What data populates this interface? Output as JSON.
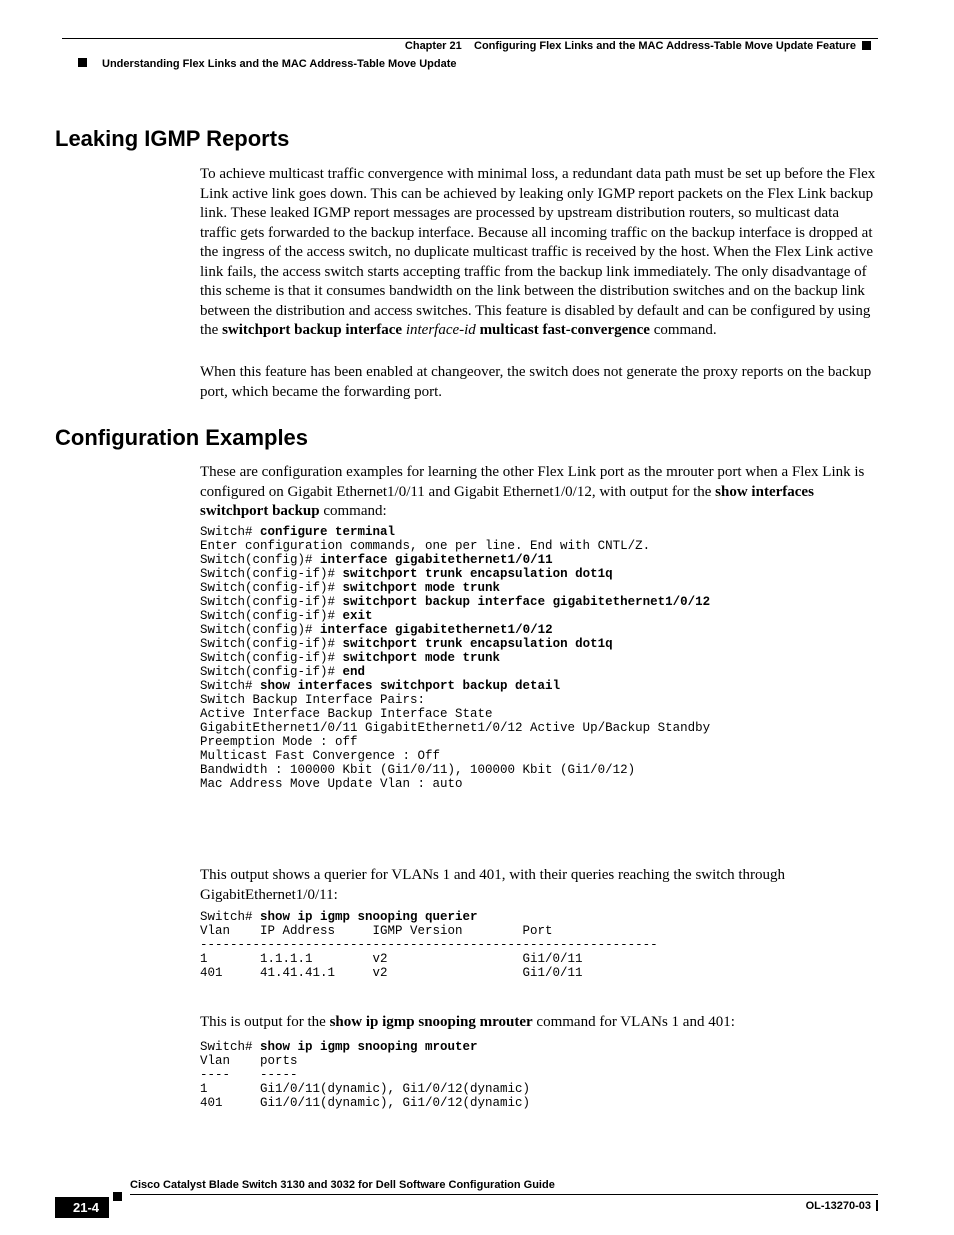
{
  "header": {
    "chapter_label": "Chapter 21",
    "chapter_title": "Configuring Flex Links and the MAC Address-Table Move Update Feature",
    "section": "Understanding Flex Links and the MAC Address-Table Move Update"
  },
  "headings": {
    "h1a": "Leaking IGMP Reports",
    "h1b": "Configuration Examples"
  },
  "paragraphs": {
    "p1_pre": "To achieve multicast traffic convergence with minimal loss, a redundant data path must be set up before the Flex Link active link goes down. This can be achieved by leaking only IGMP report packets on the Flex Link backup link. These leaked IGMP report messages are processed by upstream distribution routers, so multicast data traffic gets forwarded to the backup interface. Because all incoming traffic on the backup interface is dropped at the ingress of the access switch, no duplicate multicast traffic is received by the host. When the Flex Link active link fails, the access switch starts accepting traffic from the backup link immediately. The only disadvantage of this scheme is that it consumes bandwidth on the link between the distribution switches and on the backup link between the distribution and access switches. This feature is disabled by default and can be configured by using the ",
    "p1_b1": "switchport backup interface",
    "p1_mid1": " ",
    "p1_i1": "interface-id",
    "p1_mid2": " ",
    "p1_b2": "multicast fast-convergence",
    "p1_post": " command.",
    "p2": "When this feature has been enabled at changeover, the switch does not generate the proxy reports on the backup port, which became the forwarding port.",
    "p3_pre": "These are configuration examples for learning the other Flex Link port as the mrouter port when a Flex Link is configured on Gigabit Ethernet1/0/11 and Gigabit Ethernet1/0/12, with output for the ",
    "p3_b": "show interfaces switchport backup",
    "p3_post": " command:",
    "p4": "This output shows a querier for VLANs 1 and 401, with their queries reaching the switch through GigabitEthernet1/0/11:",
    "p5_pre": "This is output for the ",
    "p5_b": "show ip igmp snooping mrouter",
    "p5_post": " command for VLANs 1 and 401:"
  },
  "code1": {
    "l1p": "Switch# ",
    "l1b": "configure terminal",
    "l2": "Enter configuration commands, one per line. End with CNTL/Z.",
    "l3p": "Switch(config)# ",
    "l3b": "interface gigabitethernet1/0/11",
    "l4p": "Switch(config-if)# ",
    "l4b": "switchport trunk encapsulation dot1q",
    "l5p": "Switch(config-if)# ",
    "l5b": "switchport mode trunk",
    "l6p": "Switch(config-if)# ",
    "l6b": "switchport backup interface gigabitethernet1/0/12",
    "l7p": "Switch(config-if)# ",
    "l7b": "exit",
    "l8p": "Switch(config)# ",
    "l8b": "interface gigabitethernet1/0/12",
    "l9p": "Switch(config-if)# ",
    "l9b": "switchport trunk encapsulation dot1q",
    "l10p": "Switch(config-if)# ",
    "l10b": "switchport mode trunk",
    "l11p": "Switch(config-if)# ",
    "l11b": "end",
    "l12p": "Switch# ",
    "l12b": "show interfaces switchport backup detail",
    "l13": "Switch Backup Interface Pairs:",
    "l14": "Active Interface Backup Interface State",
    "l15": "GigabitEthernet1/0/11 GigabitEthernet1/0/12 Active Up/Backup Standby",
    "l16": "Preemption Mode : off",
    "l17": "Multicast Fast Convergence : Off",
    "l18": "Bandwidth : 100000 Kbit (Gi1/0/11), 100000 Kbit (Gi1/0/12)",
    "l19": "Mac Address Move Update Vlan : auto"
  },
  "code2": {
    "l1p": "Switch# ",
    "l1b": "show ip igmp snooping querier",
    "l2": "Vlan    IP Address     IGMP Version        Port",
    "l3": "-------------------------------------------------------------",
    "l4": "1       1.1.1.1        v2                  Gi1/0/11",
    "l5": "401     41.41.41.1     v2                  Gi1/0/11"
  },
  "code3": {
    "l1p": "Switch# ",
    "l1b": "show ip igmp snooping mrouter",
    "l2": "Vlan    ports",
    "l3": "----    -----",
    "l4": "1       Gi1/0/11(dynamic), Gi1/0/12(dynamic)",
    "l5": "401     Gi1/0/11(dynamic), Gi1/0/12(dynamic)"
  },
  "footer": {
    "title": "Cisco Catalyst Blade Switch 3130 and 3032 for Dell Software Configuration Guide",
    "page": "21-4",
    "docid": "OL-13270-03"
  }
}
